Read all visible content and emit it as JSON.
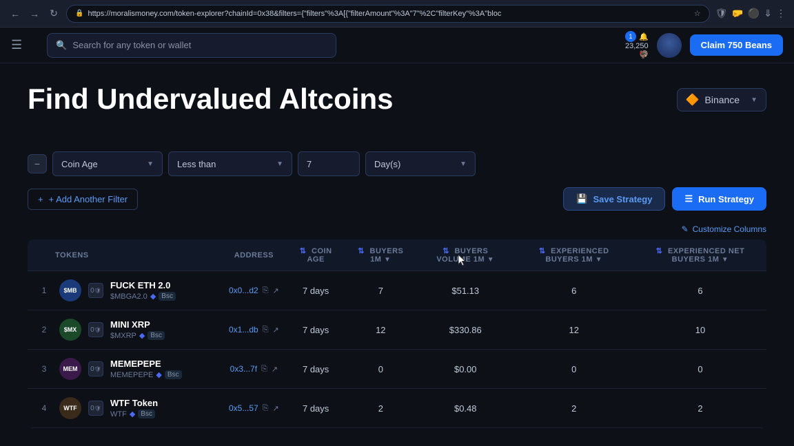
{
  "browser": {
    "url": "https://moralismoney.com/token-explorer?chainId=0x38&filters={\"filters\"%3A[{\"filterAmount\"%3A\"7\"%2C\"filterKey\"%3A\"bloc",
    "nav": {
      "back": "←",
      "forward": "→",
      "refresh": "↻"
    }
  },
  "header": {
    "search_placeholder": "Search for any token or wallet",
    "beans_count": "23,250",
    "notification_count": "1",
    "claim_button": "Claim 750 Beans"
  },
  "page": {
    "title": "Find Undervalued Altcoins",
    "chain_selector": "Binance",
    "chain_icon": "🔶"
  },
  "filter": {
    "remove_icon": "−",
    "filter_key": "Coin Age",
    "filter_operator": "Less than",
    "filter_value": "7",
    "filter_unit": "Day(s)",
    "add_filter_label": "+ Add Another Filter",
    "save_strategy_label": "Save Strategy",
    "run_strategy_label": "Run Strategy",
    "save_icon": "💾",
    "run_icon": "≡"
  },
  "table": {
    "customize_columns_label": "Customize Columns",
    "columns": [
      {
        "id": "tokens",
        "label": "TOKENS",
        "sortable": false
      },
      {
        "id": "address",
        "label": "ADDRESS",
        "sortable": false
      },
      {
        "id": "coin_age",
        "label": "COIN AGE",
        "sortable": true
      },
      {
        "id": "buyers",
        "label": "BUYERS 1M",
        "sortable": true
      },
      {
        "id": "buyers_volume",
        "label": "BUYERS VOLUME 1M",
        "sortable": true
      },
      {
        "id": "experienced_buyers",
        "label": "EXPERIENCED BUYERS 1M",
        "sortable": true
      },
      {
        "id": "experienced_net_buyers",
        "label": "EXPERIENCED NET BUYERS 1M",
        "sortable": true
      }
    ],
    "rows": [
      {
        "num": "1",
        "logo_text": "$MB",
        "logo_color": "#1a3a7a",
        "name": "FUCK ETH 2.0",
        "ticker": "$MBGA2.0",
        "chain": "Bsc",
        "shield": "0",
        "address": "0x0...d2",
        "coin_age": "7 days",
        "buyers": "7",
        "buyers_volume": "$51.13",
        "experienced_buyers": "6",
        "experienced_net_buyers": "6"
      },
      {
        "num": "2",
        "logo_text": "$MX",
        "logo_color": "#1a4a2a",
        "name": "MINI XRP",
        "ticker": "$MXRP",
        "chain": "Bsc",
        "shield": "0",
        "address": "0x1...db",
        "coin_age": "7 days",
        "buyers": "12",
        "buyers_volume": "$330.86",
        "experienced_buyers": "12",
        "experienced_net_buyers": "10"
      },
      {
        "num": "3",
        "logo_text": "MEM",
        "logo_color": "#3a1a4a",
        "name": "MEMEPEPE",
        "ticker": "MEMEPEPE",
        "chain": "Bsc",
        "shield": "0",
        "address": "0x3...7f",
        "coin_age": "7 days",
        "buyers": "0",
        "buyers_volume": "$0.00",
        "experienced_buyers": "0",
        "experienced_net_buyers": "0"
      },
      {
        "num": "4",
        "logo_text": "WTF",
        "logo_color": "#3a2a1a",
        "name": "WTF Token",
        "ticker": "WTF",
        "chain": "Bsc",
        "shield": "0",
        "address": "0x5...57",
        "coin_age": "7 days",
        "buyers": "2",
        "buyers_volume": "$0.48",
        "experienced_buyers": "2",
        "experienced_net_buyers": "2"
      }
    ]
  }
}
